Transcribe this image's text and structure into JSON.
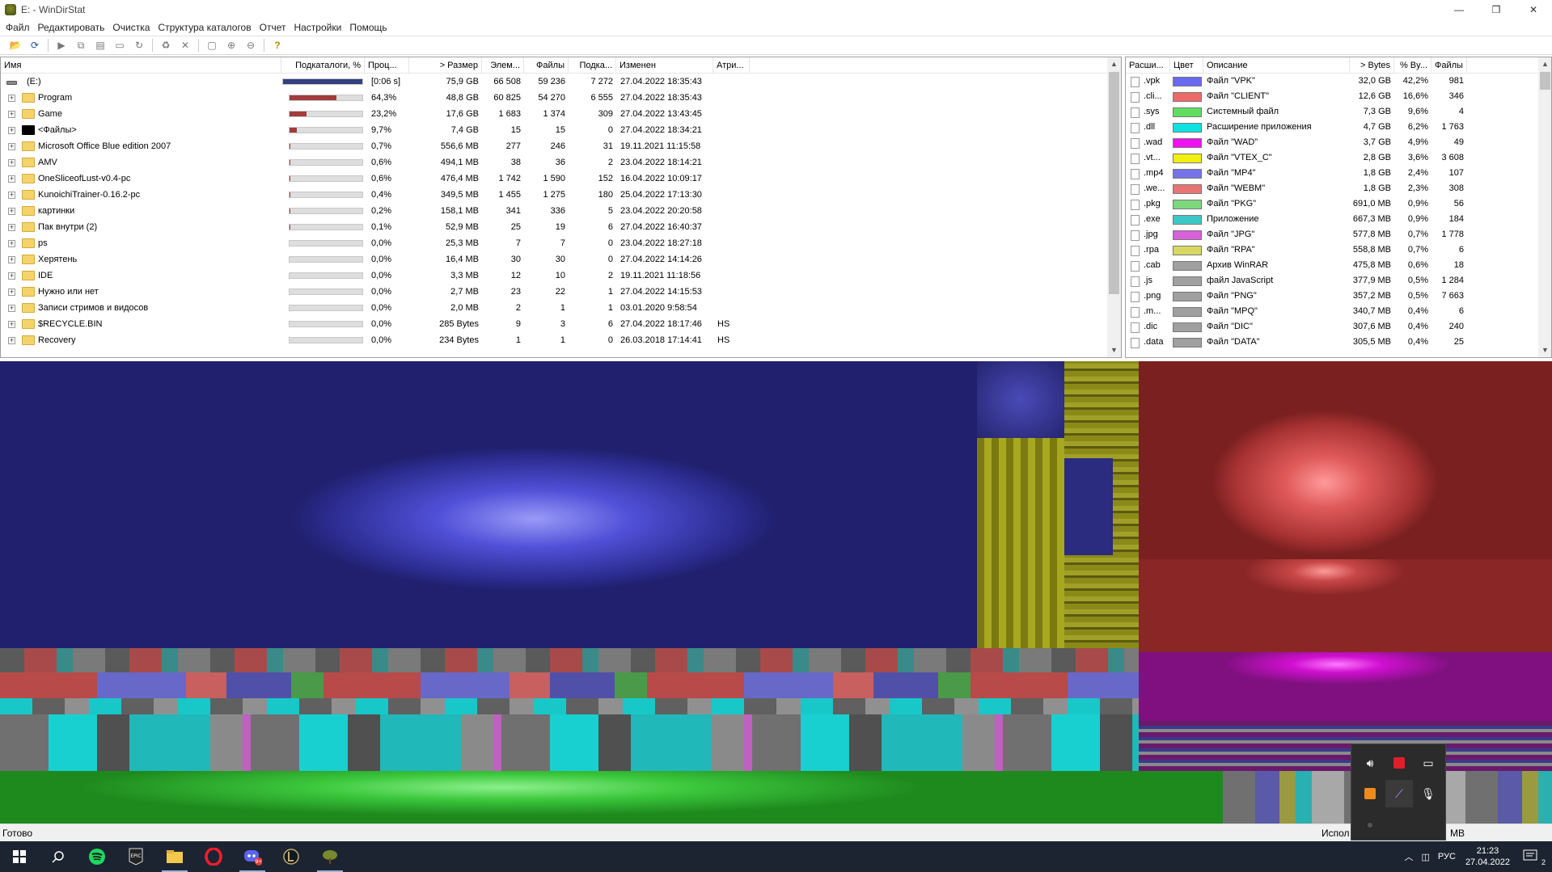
{
  "window": {
    "title": "E: - WinDirStat",
    "min": "—",
    "max": "❐",
    "close": "✕"
  },
  "menu": [
    "Файл",
    "Редактировать",
    "Очистка",
    "Структура каталогов",
    "Отчет",
    "Настройки",
    "Помощь"
  ],
  "toolbar_icons": [
    "open-icon",
    "refresh-all-icon",
    "sep",
    "play-icon",
    "copy-icon",
    "copy-path-icon",
    "explorer-icon",
    "refresh-icon",
    "sep",
    "recycle-icon",
    "delete-icon",
    "sep",
    "new-folder-icon",
    "zoom-in-icon",
    "zoom-out-icon",
    "sep",
    "help-icon"
  ],
  "tree": {
    "headers": [
      "Имя",
      "Подкаталоги, %",
      "Проц...",
      "> Размер",
      "Элем...",
      "Файлы",
      "Подка...",
      "Изменен",
      "Атри..."
    ],
    "rows": [
      {
        "name": "(E:)",
        "icon": "drive",
        "expander": "",
        "pct_bar": 100,
        "bar_color": "#34407e",
        "pct": "[0:06 s]",
        "size": "75,9 GB",
        "items": "66 508",
        "files": "59 236",
        "subdirs": "7 272",
        "modified": "27.04.2022  18:35:43",
        "attr": ""
      },
      {
        "name": "Program",
        "icon": "folder",
        "expander": "+",
        "pct_bar": 64.3,
        "bar_color": "#a23b3b",
        "pct": "64,3%",
        "size": "48,8 GB",
        "items": "60 825",
        "files": "54 270",
        "subdirs": "6 555",
        "modified": "27.04.2022  18:35:43",
        "attr": ""
      },
      {
        "name": "Game",
        "icon": "folder",
        "expander": "+",
        "pct_bar": 23.2,
        "bar_color": "#a23b3b",
        "pct": "23,2%",
        "size": "17,6 GB",
        "items": "1 683",
        "files": "1 374",
        "subdirs": "309",
        "modified": "27.04.2022  13:43:45",
        "attr": ""
      },
      {
        "name": "<Файлы>",
        "icon": "black",
        "expander": "+",
        "pct_bar": 9.7,
        "bar_color": "#a23b3b",
        "pct": "9,7%",
        "size": "7,4 GB",
        "items": "15",
        "files": "15",
        "subdirs": "0",
        "modified": "27.04.2022  18:34:21",
        "attr": ""
      },
      {
        "name": "Microsoft Office Blue edition 2007",
        "icon": "folder",
        "expander": "+",
        "pct_bar": 0.7,
        "bar_color": "#a23b3b",
        "pct": "0,7%",
        "size": "556,6 MB",
        "items": "277",
        "files": "246",
        "subdirs": "31",
        "modified": "19.11.2021  11:15:58",
        "attr": ""
      },
      {
        "name": "AMV",
        "icon": "folder",
        "expander": "+",
        "pct_bar": 0.6,
        "bar_color": "#a23b3b",
        "pct": "0,6%",
        "size": "494,1 MB",
        "items": "38",
        "files": "36",
        "subdirs": "2",
        "modified": "23.04.2022  18:14:21",
        "attr": ""
      },
      {
        "name": "OneSliceofLust-v0.4-pc",
        "icon": "folder",
        "expander": "+",
        "pct_bar": 0.6,
        "bar_color": "#a23b3b",
        "pct": "0,6%",
        "size": "476,4 MB",
        "items": "1 742",
        "files": "1 590",
        "subdirs": "152",
        "modified": "16.04.2022  10:09:17",
        "attr": ""
      },
      {
        "name": "KunoichiTrainer-0.16.2-pc",
        "icon": "folder",
        "expander": "+",
        "pct_bar": 0.4,
        "bar_color": "#a23b3b",
        "pct": "0,4%",
        "size": "349,5 MB",
        "items": "1 455",
        "files": "1 275",
        "subdirs": "180",
        "modified": "25.04.2022  17:13:30",
        "attr": ""
      },
      {
        "name": "картинки",
        "icon": "folder",
        "expander": "+",
        "pct_bar": 0.2,
        "bar_color": "#a23b3b",
        "pct": "0,2%",
        "size": "158,1 MB",
        "items": "341",
        "files": "336",
        "subdirs": "5",
        "modified": "23.04.2022  20:20:58",
        "attr": ""
      },
      {
        "name": "Пак внутри (2)",
        "icon": "folder",
        "expander": "+",
        "pct_bar": 0.1,
        "bar_color": "#a23b3b",
        "pct": "0,1%",
        "size": "52,9 MB",
        "items": "25",
        "files": "19",
        "subdirs": "6",
        "modified": "27.04.2022  16:40:37",
        "attr": ""
      },
      {
        "name": "ps",
        "icon": "folder",
        "expander": "+",
        "pct_bar": 0,
        "bar_color": "#a23b3b",
        "pct": "0,0%",
        "size": "25,3 MB",
        "items": "7",
        "files": "7",
        "subdirs": "0",
        "modified": "23.04.2022  18:27:18",
        "attr": ""
      },
      {
        "name": "Херятень",
        "icon": "folder",
        "expander": "+",
        "pct_bar": 0,
        "bar_color": "#a23b3b",
        "pct": "0,0%",
        "size": "16,4 MB",
        "items": "30",
        "files": "30",
        "subdirs": "0",
        "modified": "27.04.2022  14:14:26",
        "attr": ""
      },
      {
        "name": "IDE",
        "icon": "folder",
        "expander": "+",
        "pct_bar": 0,
        "bar_color": "#a23b3b",
        "pct": "0,0%",
        "size": "3,3 MB",
        "items": "12",
        "files": "10",
        "subdirs": "2",
        "modified": "19.11.2021  11:18:56",
        "attr": ""
      },
      {
        "name": "Нужно или нет",
        "icon": "folder",
        "expander": "+",
        "pct_bar": 0,
        "bar_color": "#a23b3b",
        "pct": "0,0%",
        "size": "2,7 MB",
        "items": "23",
        "files": "22",
        "subdirs": "1",
        "modified": "27.04.2022  14:15:53",
        "attr": ""
      },
      {
        "name": "Записи стримов и видосов",
        "icon": "folder",
        "expander": "+",
        "pct_bar": 0,
        "bar_color": "#a23b3b",
        "pct": "0,0%",
        "size": "2,0 MB",
        "items": "2",
        "files": "1",
        "subdirs": "1",
        "modified": "03.01.2020  9:58:54",
        "attr": ""
      },
      {
        "name": "$RECYCLE.BIN",
        "icon": "folder",
        "expander": "+",
        "pct_bar": 0,
        "bar_color": "#a23b3b",
        "pct": "0,0%",
        "size": "285 Bytes",
        "items": "9",
        "files": "3",
        "subdirs": "6",
        "modified": "27.04.2022  18:17:46",
        "attr": "HS"
      },
      {
        "name": "Recovery",
        "icon": "folder",
        "expander": "+",
        "pct_bar": 0,
        "bar_color": "#a23b3b",
        "pct": "0,0%",
        "size": "234 Bytes",
        "items": "1",
        "files": "1",
        "subdirs": "0",
        "modified": "26.03.2018  17:14:41",
        "attr": "HS"
      }
    ]
  },
  "extensions": {
    "headers": [
      "Расши...",
      "Цвет",
      "Описание",
      "> Bytes",
      "% By...",
      "Файлы"
    ],
    "rows": [
      {
        "ext": ".vpk",
        "color": "#6a6af0",
        "desc": "Файл \"VPK\"",
        "bytes": "32,0 GB",
        "pct": "42,2%",
        "files": "981"
      },
      {
        "ext": ".cli...",
        "color": "#f06a6a",
        "desc": "Файл \"CLIENT\"",
        "bytes": "12,6 GB",
        "pct": "16,6%",
        "files": "346"
      },
      {
        "ext": ".sys",
        "color": "#5ee05e",
        "desc": "Системный файл",
        "bytes": "7,3 GB",
        "pct": "9,6%",
        "files": "4"
      },
      {
        "ext": ".dll",
        "color": "#10e0e0",
        "desc": "Расширение приложения",
        "bytes": "4,7 GB",
        "pct": "6,2%",
        "files": "1 763"
      },
      {
        "ext": ".wad",
        "color": "#f010f0",
        "desc": "Файл \"WAD\"",
        "bytes": "3,7 GB",
        "pct": "4,9%",
        "files": "49"
      },
      {
        "ext": ".vt...",
        "color": "#f0f010",
        "desc": "Файл \"VTEX_C\"",
        "bytes": "2,8 GB",
        "pct": "3,6%",
        "files": "3 608"
      },
      {
        "ext": ".mp4",
        "color": "#7474e8",
        "desc": "Файл \"MP4\"",
        "bytes": "1,8 GB",
        "pct": "2,4%",
        "files": "107"
      },
      {
        "ext": ".we...",
        "color": "#e87474",
        "desc": "Файл \"WEBM\"",
        "bytes": "1,8 GB",
        "pct": "2,3%",
        "files": "308"
      },
      {
        "ext": ".pkg",
        "color": "#7ed87e",
        "desc": "Файл \"PKG\"",
        "bytes": "691,0 MB",
        "pct": "0,9%",
        "files": "56"
      },
      {
        "ext": ".exe",
        "color": "#3cc8c8",
        "desc": "Приложение",
        "bytes": "667,3 MB",
        "pct": "0,9%",
        "files": "184"
      },
      {
        "ext": ".jpg",
        "color": "#d860d8",
        "desc": "Файл \"JPG\"",
        "bytes": "577,8 MB",
        "pct": "0,7%",
        "files": "1 778"
      },
      {
        "ext": ".rpa",
        "color": "#d8d860",
        "desc": "Файл \"RPA\"",
        "bytes": "558,8 MB",
        "pct": "0,7%",
        "files": "6"
      },
      {
        "ext": ".cab",
        "color": "#a0a0a0",
        "desc": "Архив WinRAR",
        "bytes": "475,8 MB",
        "pct": "0,6%",
        "files": "18"
      },
      {
        "ext": ".js",
        "color": "#a0a0a0",
        "desc": "файл JavaScript",
        "bytes": "377,9 MB",
        "pct": "0,5%",
        "files": "1 284"
      },
      {
        "ext": ".png",
        "color": "#a0a0a0",
        "desc": "Файл \"PNG\"",
        "bytes": "357,2 MB",
        "pct": "0,5%",
        "files": "7 663"
      },
      {
        "ext": ".m...",
        "color": "#a0a0a0",
        "desc": "Файл \"MPQ\"",
        "bytes": "340,7 MB",
        "pct": "0,4%",
        "files": "6"
      },
      {
        "ext": ".dic",
        "color": "#a0a0a0",
        "desc": "Файл \"DIC\"",
        "bytes": "307,6 MB",
        "pct": "0,4%",
        "files": "240"
      },
      {
        "ext": ".data",
        "color": "#a0a0a0",
        "desc": "Файл \"DATA\"",
        "bytes": "305,5 MB",
        "pct": "0,4%",
        "files": "25"
      }
    ]
  },
  "status": {
    "left": "Готово",
    "right_a": "Испол",
    "right_b": "MB"
  },
  "taskbar": {
    "apps": [
      "windows-start-icon",
      "search-icon",
      "spotify-icon",
      "epic-games-icon",
      "file-explorer-icon",
      "opera-icon",
      "discord-icon",
      "league-of-legends-icon",
      "windirstat-icon"
    ],
    "badge": "9+",
    "lang": "РУС",
    "time": "21:23",
    "date": "27.04.2022",
    "notif": "2"
  },
  "tray_flyout": [
    "volume-icon",
    "app-red-icon",
    "display-icon",
    "app-orange-icon",
    "feather-icon",
    "microphone-icon",
    "app-gray-icon"
  ]
}
